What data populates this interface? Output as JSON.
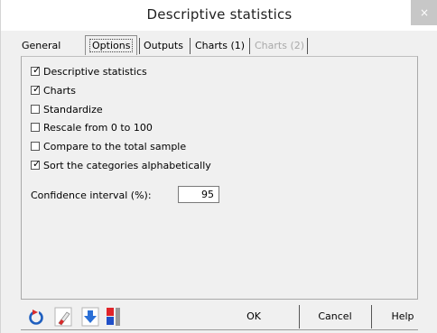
{
  "window": {
    "title": "Descriptive statistics",
    "close_label": "×"
  },
  "tabs": [
    {
      "label": "General",
      "selected": false,
      "disabled": false
    },
    {
      "label": "Options",
      "selected": true,
      "disabled": false
    },
    {
      "label": "Outputs",
      "selected": false,
      "disabled": false
    },
    {
      "label": "Charts (1)",
      "selected": false,
      "disabled": false
    },
    {
      "label": "Charts (2)",
      "selected": false,
      "disabled": true
    }
  ],
  "options": [
    {
      "label": "Descriptive statistics",
      "checked": true
    },
    {
      "label": "Charts",
      "checked": true
    },
    {
      "label": "Standardize",
      "checked": false
    },
    {
      "label": "Rescale from 0 to 100",
      "checked": false
    },
    {
      "label": "Compare to the total sample",
      "checked": false
    },
    {
      "label": "Sort the categories alphabetically",
      "checked": true
    }
  ],
  "confidence": {
    "label": "Confidence interval (%):",
    "value": "95"
  },
  "buttons": {
    "ok": "OK",
    "cancel": "Cancel",
    "help": "Help"
  },
  "toolbar_icons": [
    "reset-icon",
    "eraser-icon",
    "down-arrow-icon",
    "color-blocks-icon"
  ],
  "colors": {
    "reset_blue": "#1f5fbf",
    "reset_red": "#d92b2b",
    "arrow_blue": "#2a6fd6",
    "block_red": "#e0242a",
    "block_blue": "#2150c8"
  },
  "check_mark": "✓"
}
